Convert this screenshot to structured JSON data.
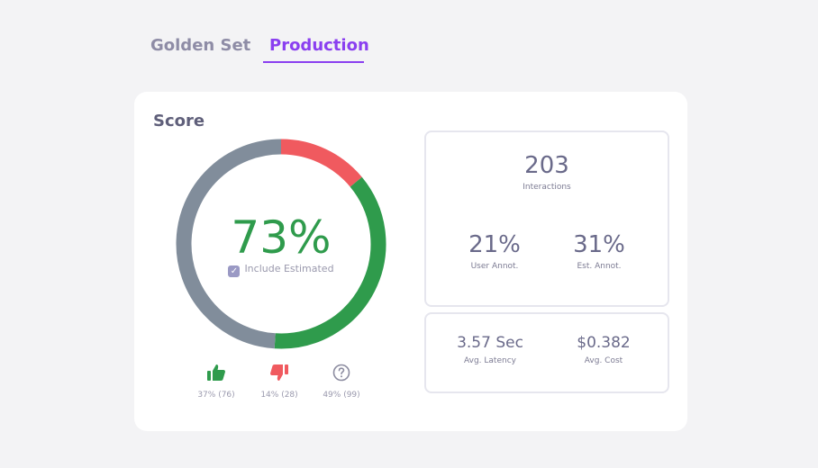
{
  "tabs": {
    "golden": "Golden Set",
    "production": "Production"
  },
  "score": {
    "title": "Score",
    "value": "73%",
    "estimated_label": "Include Estimated",
    "include_estimated": true,
    "segments": [
      {
        "name": "negative",
        "fraction": 0.14,
        "color": "#f05a5f"
      },
      {
        "name": "positive",
        "fraction": 0.37,
        "color": "#2f9b4c"
      },
      {
        "name": "unknown",
        "fraction": 0.49,
        "color": "#818d9b"
      }
    ]
  },
  "feedback": {
    "positive": {
      "label": "37% (76)",
      "icon": "thumbs-up-icon",
      "color": "#2f9b4c"
    },
    "negative": {
      "label": "14% (28)",
      "icon": "thumbs-down-icon",
      "color": "#f05a5f"
    },
    "unknown": {
      "label": "49% (99)",
      "icon": "question-circle-icon",
      "color": "#8c8ca0"
    }
  },
  "stats": {
    "interactions": {
      "value": "203",
      "label": "Interactions"
    },
    "user_annot": {
      "value": "21%",
      "label": "User Annot."
    },
    "est_annot": {
      "value": "31%",
      "label": "Est. Annot."
    },
    "latency": {
      "value": "3.57 Sec",
      "label": "Avg. Latency"
    },
    "cost": {
      "value": "$0.382",
      "label": "Avg. Cost"
    }
  }
}
